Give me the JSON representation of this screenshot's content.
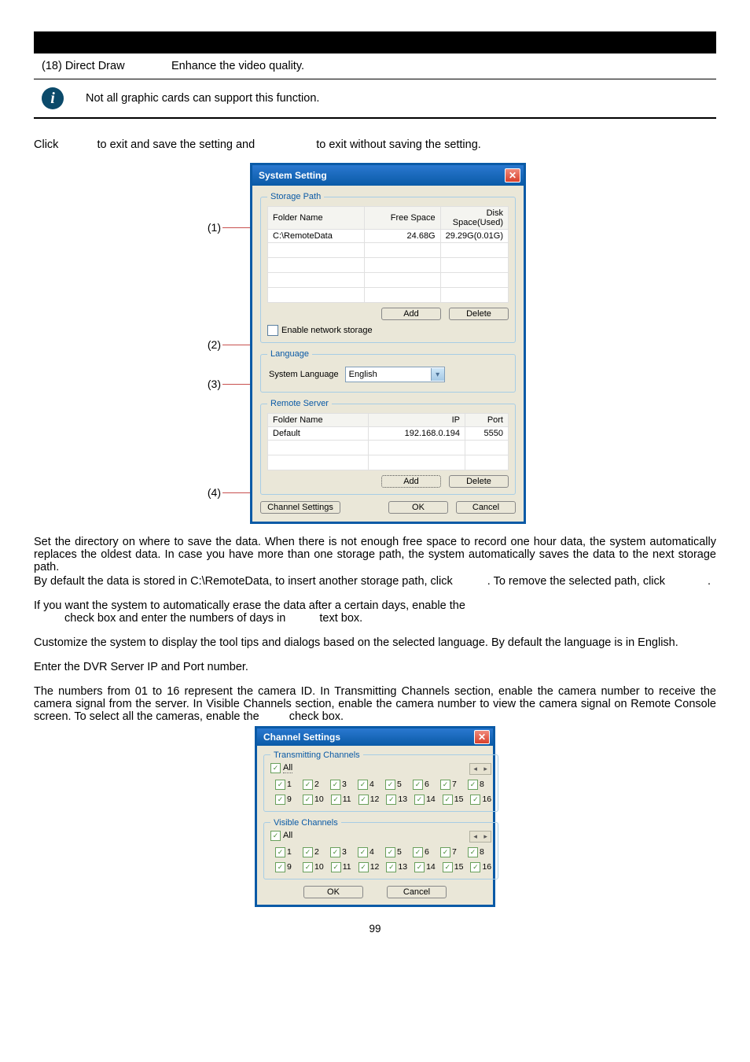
{
  "row18": {
    "col1": "(18) Direct Draw",
    "col2": "Enhance the video quality."
  },
  "note": "Not all graphic cards can support this function.",
  "exit": {
    "p1": "Click",
    "p2": "to exit and save the setting and",
    "p3": "to exit without saving the setting."
  },
  "callouts": {
    "c1": "(1)",
    "c2": "(2)",
    "c3": "(3)",
    "c4": "(4)"
  },
  "dlg": {
    "title": "System Setting",
    "storage": {
      "legend": "Storage Path",
      "h1": "Folder Name",
      "h2": "Free Space",
      "h3": "Disk Space(Used)",
      "r1c1": "C:\\RemoteData",
      "r1c2": "24.68G",
      "r1c3": "29.29G(0.01G)",
      "add": "Add",
      "delete": "Delete",
      "enable": "Enable network storage"
    },
    "lang": {
      "legend": "Language",
      "label": "System Language",
      "value": "English"
    },
    "remote": {
      "legend": "Remote Server",
      "h1": "Folder Name",
      "h2": "IP",
      "h3": "Port",
      "r1c1": "Default",
      "r1c2": "192.168.0.194",
      "r1c3": "5550",
      "add": "Add",
      "delete": "Delete"
    },
    "foot": {
      "chs": "Channel Settings",
      "ok": "OK",
      "cancel": "Cancel"
    }
  },
  "paras": {
    "p1": "Set the directory on where to save the data. When there is not enough free space to record one hour data, the system automatically replaces the oldest data. In case you have more than one storage path, the system automatically saves the data to the next storage path.",
    "p2a": "By default the data is stored in C:\\RemoteData, to insert another storage path, click ",
    "p2b": ". To remove the selected path, click ",
    "p2c": ".",
    "p3a": "If you want the system to automatically erase the data after a certain days, enable the ",
    "p3b": " check box and enter the numbers of days in ",
    "p3c": " text box.",
    "p4": "Customize the system to display the tool tips and dialogs based on the selected language. By default the language is in English.",
    "p5": "Enter the DVR Server IP and Port number.",
    "p6a": "The numbers from 01 to 16 represent the camera ID. In Transmitting Channels section, enable the camera number to receive the camera signal from the server. In Visible Channels section, enable the camera number to view the camera signal on Remote Console screen. To select all the cameras, enable the ",
    "p6b": " check box."
  },
  "dlg2": {
    "title": "Channel Settings",
    "all": "All",
    "trans": "Transmitting Channels",
    "vis": "Visible Channels",
    "nums": [
      "1",
      "2",
      "3",
      "4",
      "5",
      "6",
      "7",
      "8",
      "9",
      "10",
      "11",
      "12",
      "13",
      "14",
      "15",
      "16"
    ],
    "ok": "OK",
    "cancel": "Cancel"
  },
  "pagenum": "99"
}
